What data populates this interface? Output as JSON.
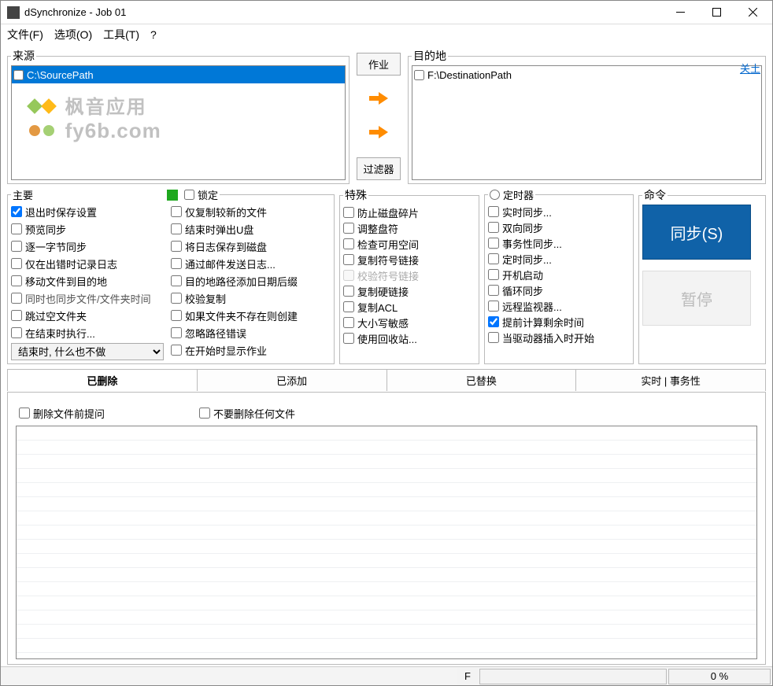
{
  "window": {
    "title": "dSynchronize - Job 01"
  },
  "menu": {
    "file": "文件(F)",
    "options": "选项(O)",
    "tools": "工具(T)",
    "help": "?"
  },
  "source": {
    "legend": "来源",
    "path": "C:\\SourcePath",
    "watermark_line1": "枫音应用",
    "watermark_line2": "fy6b.com"
  },
  "dest": {
    "legend": "目的地",
    "path": "F:\\DestinationPath",
    "close_link": "关土"
  },
  "mid": {
    "job": "作业",
    "filter": "过滤器"
  },
  "main": {
    "legend": "主要",
    "lock": "锁定",
    "col1": {
      "save_on_exit": "退出时保存设置",
      "preview_sync": "预览同步",
      "byte_by_byte": "逐一字节同步",
      "log_only_err": "仅在出错时记录日志",
      "move_to_dest": "移动文件到目的地",
      "also_sync_times": "同时也同步文件/文件夹时间",
      "skip_empty": "跳过空文件夹",
      "exec_on_end": "在结束时执行..."
    },
    "col2": {
      "copy_newer": "仅复制较新的文件",
      "eject_u": "结束时弹出U盘",
      "save_log": "将日志保存到磁盘",
      "email_log": "通过邮件发送日志...",
      "dest_date_suffix": "目的地路径添加日期后缀",
      "verify_copy": "校验复制",
      "create_if_missing": "如果文件夹不存在则创建",
      "ignore_path_err": "忽略路径错误",
      "show_job_on_start": "在开始时显示作业"
    },
    "combo_value": "结束时, 什么也不做"
  },
  "special": {
    "legend": "特殊",
    "anti_frag": "防止磁盘碎片",
    "adjust_drive": "调整盘符",
    "check_space": "检查可用空间",
    "copy_symlink": "复制符号链接",
    "verify_symlink": "校验符号链接",
    "copy_hardlink": "复制硬链接",
    "copy_acl": "复制ACL",
    "case_sensitive": "大小写敏感",
    "use_recycle": "使用回收站..."
  },
  "timer": {
    "legend": "定时器",
    "realtime": "实时同步...",
    "bidir": "双向同步",
    "transactional": "事务性同步...",
    "scheduled": "定时同步...",
    "autostart": "开机启动",
    "loop": "循环同步",
    "remote_mon": "远程监视器...",
    "calc_ahead": "提前计算剩余时间",
    "on_drive_insert": "当驱动器插入时开始"
  },
  "cmd": {
    "legend": "命令",
    "sync": "同步(S)",
    "pause": "暂停"
  },
  "tabs": {
    "deleted": "已删除",
    "added": "已添加",
    "replaced": "已替换",
    "realtime": "实时 | 事务性"
  },
  "tab_opts": {
    "ask_before_delete": "删除文件前提问",
    "dont_delete_any": "不要删除任何文件"
  },
  "status": {
    "f": "F",
    "percent": "0 %"
  }
}
